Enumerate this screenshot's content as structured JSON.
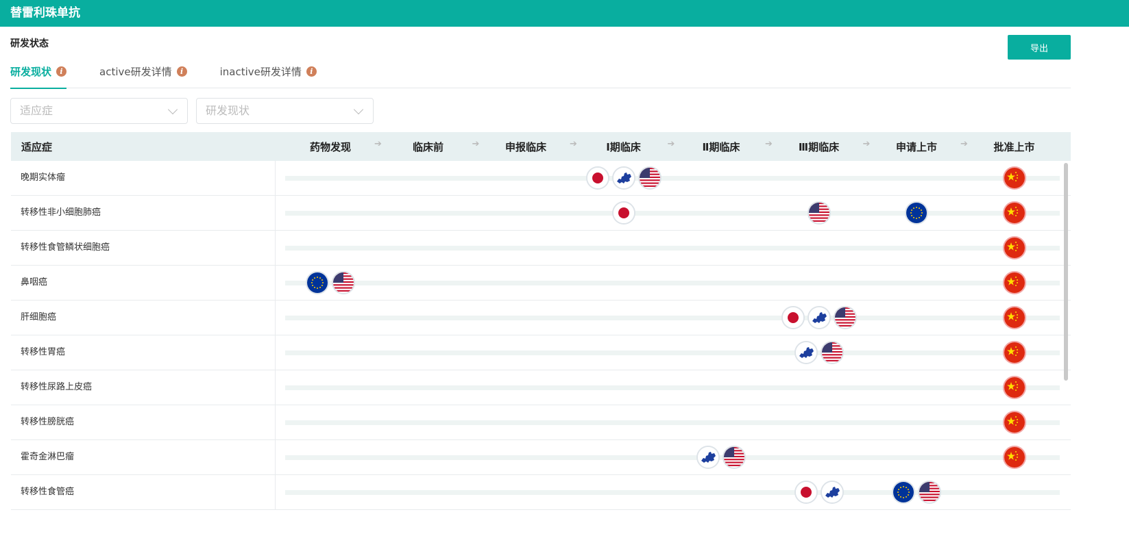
{
  "app_title": "替雷利珠单抗",
  "section_title": "研发状态",
  "export_label": "导出",
  "tabs": [
    {
      "label": "研发现状",
      "active": true
    },
    {
      "label": "active研发详情",
      "active": false
    },
    {
      "label": "inactive研发详情",
      "active": false
    }
  ],
  "info_icon": "i",
  "filters": [
    {
      "placeholder": "适应症"
    },
    {
      "placeholder": "研发现状"
    }
  ],
  "table": {
    "indication_header": "适应症",
    "stages": [
      "药物发现",
      "临床前",
      "申报临床",
      "Ⅰ期临床",
      "Ⅱ期临床",
      "Ⅲ期临床",
      "申请上市",
      "批准上市"
    ],
    "rows": [
      {
        "name": "晚期实体瘤",
        "markers": [
          {
            "stage": 3,
            "flags": [
              "jp",
              "eu-map",
              "us"
            ]
          },
          {
            "stage": 7,
            "flags": [
              "cn"
            ]
          }
        ]
      },
      {
        "name": "转移性非小细胞肺癌",
        "markers": [
          {
            "stage": 3,
            "flags": [
              "jp"
            ]
          },
          {
            "stage": 5,
            "flags": [
              "us"
            ]
          },
          {
            "stage": 6,
            "flags": [
              "eu"
            ]
          },
          {
            "stage": 7,
            "flags": [
              "cn"
            ]
          }
        ]
      },
      {
        "name": "转移性食管鳞状细胞癌",
        "markers": [
          {
            "stage": 7,
            "flags": [
              "cn"
            ]
          }
        ]
      },
      {
        "name": "鼻咽癌",
        "markers": [
          {
            "stage": 0,
            "flags": [
              "eu",
              "us"
            ]
          },
          {
            "stage": 7,
            "flags": [
              "cn"
            ]
          }
        ]
      },
      {
        "name": "肝细胞癌",
        "markers": [
          {
            "stage": 5,
            "flags": [
              "jp",
              "eu-map",
              "us"
            ]
          },
          {
            "stage": 7,
            "flags": [
              "cn"
            ]
          }
        ]
      },
      {
        "name": "转移性胃癌",
        "markers": [
          {
            "stage": 5,
            "flags": [
              "eu-map",
              "us"
            ]
          },
          {
            "stage": 7,
            "flags": [
              "cn"
            ]
          }
        ]
      },
      {
        "name": "转移性尿路上皮癌",
        "markers": [
          {
            "stage": 7,
            "flags": [
              "cn"
            ]
          }
        ]
      },
      {
        "name": "转移性膀胱癌",
        "markers": [
          {
            "stage": 7,
            "flags": [
              "cn"
            ]
          }
        ]
      },
      {
        "name": "霍奇金淋巴瘤",
        "markers": [
          {
            "stage": 4,
            "flags": [
              "eu-map",
              "us"
            ]
          },
          {
            "stage": 7,
            "flags": [
              "cn"
            ]
          }
        ]
      },
      {
        "name": "转移性食管癌",
        "markers": [
          {
            "stage": 5,
            "flags": [
              "jp",
              "eu-map"
            ]
          },
          {
            "stage": 6,
            "flags": [
              "eu",
              "us"
            ]
          }
        ]
      }
    ]
  },
  "colors": {
    "brand": "#09ae9f",
    "info": "#d0805a"
  }
}
